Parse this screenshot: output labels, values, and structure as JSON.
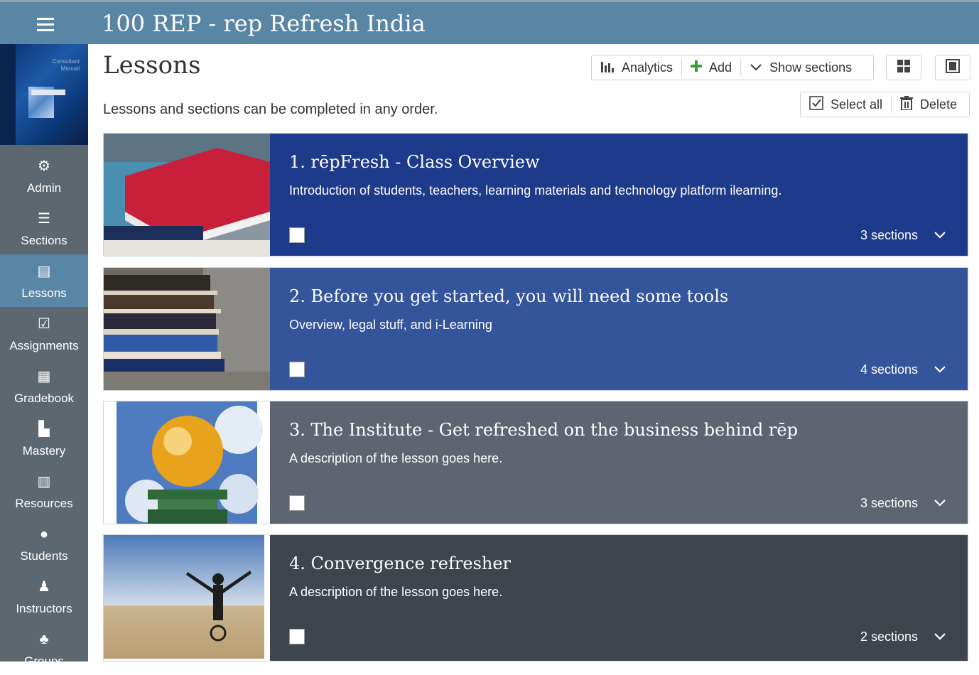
{
  "app": {
    "title": "100 REP - rep Refresh India"
  },
  "sidebar": {
    "course_thumb_text": "Consultant Manual",
    "items": [
      {
        "label": "Admin",
        "icon": "gear-icon"
      },
      {
        "label": "Sections",
        "icon": "list-icon"
      },
      {
        "label": "Lessons",
        "icon": "notebook-icon",
        "active": true
      },
      {
        "label": "Assignments",
        "icon": "checkbox-icon"
      },
      {
        "label": "Gradebook",
        "icon": "grid-book-icon"
      },
      {
        "label": "Mastery",
        "icon": "bar-chart-icon"
      },
      {
        "label": "Resources",
        "icon": "books-icon"
      },
      {
        "label": "Students",
        "icon": "person-icon"
      },
      {
        "label": "Instructors",
        "icon": "instructor-icon"
      },
      {
        "label": "Groups",
        "icon": "group-icon"
      }
    ]
  },
  "main": {
    "title": "Lessons",
    "subtitle": "Lessons and sections can be completed in any order.",
    "toolbar": {
      "analytics_label": "Analytics",
      "add_label": "Add",
      "show_sections_label": "Show sections",
      "select_all_label": "Select all",
      "delete_label": "Delete"
    },
    "lessons": [
      {
        "title": "1. rēpFresh - Class Overview",
        "description": "Introduction of students, teachers, learning materials and technology platform ilearning.",
        "sections": "3 sections",
        "color": "#1e3a8a"
      },
      {
        "title": "2. Before you get started, you will need some tools",
        "description": "Overview, legal stuff, and i-Learning",
        "sections": "4 sections",
        "color": "#34549c"
      },
      {
        "title": "3. The Institute - Get refreshed on the business behind rēp",
        "description": "A description of the lesson goes here.",
        "sections": "3 sections",
        "color": "#5e6570"
      },
      {
        "title": "4. Convergence refresher",
        "description": "A description of the lesson goes here.",
        "sections": "2 sections",
        "color": "#3f454d"
      }
    ]
  },
  "colors": {
    "topbar": "#5a86a6",
    "sidebar": "#5d6770",
    "active_nav": "#5a86a6",
    "add_plus": "#3a9a3a"
  }
}
